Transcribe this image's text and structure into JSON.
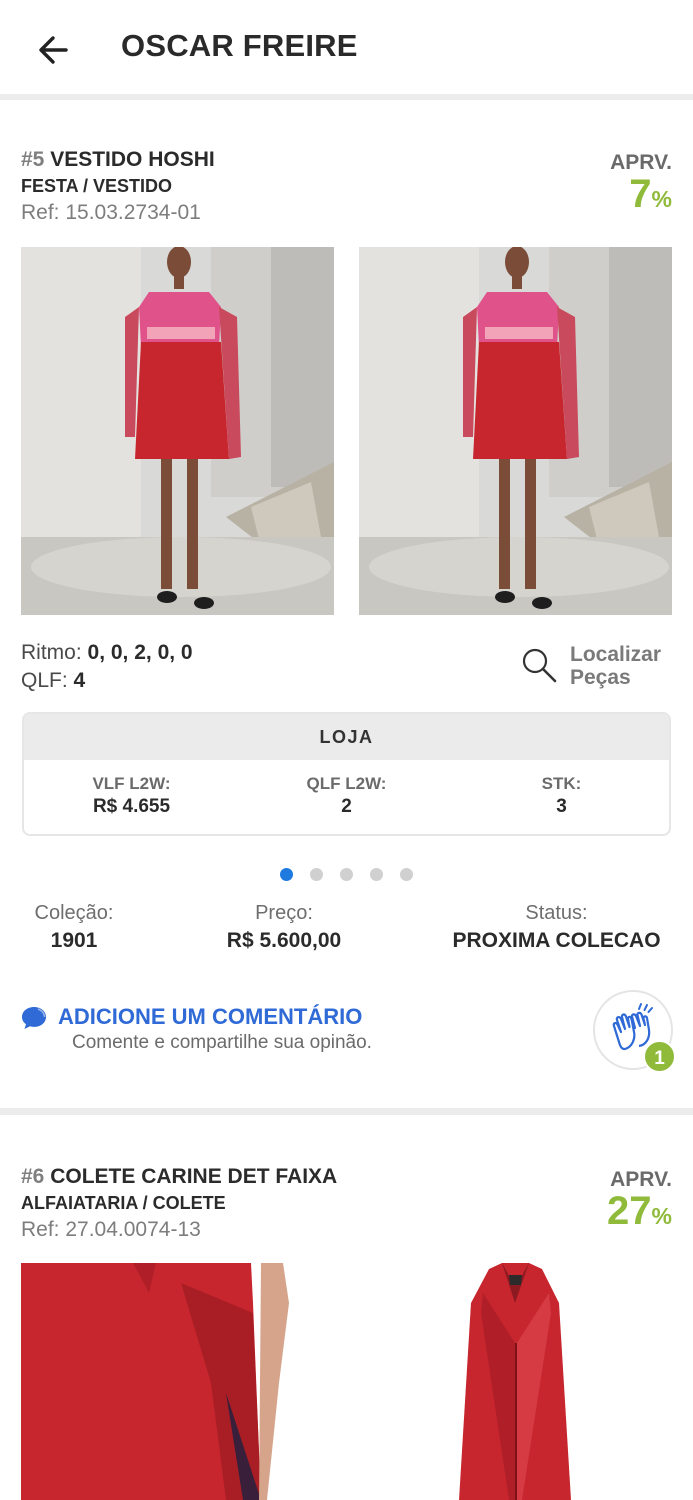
{
  "header": {
    "back_icon": "arrow-left-icon",
    "title": "OSCAR FREIRE"
  },
  "products": [
    {
      "number_prefix": "#5",
      "name": "VESTIDO HOSHI",
      "category": "FESTA / VESTIDO",
      "ref": "Ref: 15.03.2734-01",
      "approval_label": "APRV.",
      "approval_value": "7",
      "approval_unit": "%",
      "ritmo_label": "Ritmo:",
      "ritmo_value": "0, 0, 2, 0, 0",
      "qlf_label": "QLF:",
      "qlf_value": "4",
      "localizar_line1": "Localizar",
      "localizar_line2": "Peças",
      "loja": {
        "title": "LOJA",
        "columns": [
          {
            "label": "VLF L2W:",
            "value": "R$ 4.655"
          },
          {
            "label": "QLF L2W:",
            "value": "2"
          },
          {
            "label": "STK:",
            "value": "3"
          }
        ]
      },
      "carousel": {
        "count": 5,
        "active_index": 0
      },
      "info": [
        {
          "label": "Coleção:",
          "value": "1901"
        },
        {
          "label": "Preço:",
          "value": "R$ 5.600,00"
        },
        {
          "label": "Status:",
          "value": "PROXIMA COLECAO"
        }
      ],
      "comment_title": "ADICIONE UM COMENTÁRIO",
      "comment_subtitle": "Comente e compartilhe sua opinão.",
      "clap_count": "1"
    },
    {
      "number_prefix": "#6",
      "name": "COLETE CARINE DET FAIXA",
      "category": "ALFAIATARIA / COLETE",
      "ref": "Ref: 27.04.0074-13",
      "approval_label": "APRV.",
      "approval_value": "27",
      "approval_unit": "%"
    }
  ],
  "colors": {
    "accent_green": "#8fba3a",
    "link_blue": "#2f6ad6",
    "active_dot": "#1f7ae0",
    "dress_red": "#c8262e",
    "dress_pink": "#e0528a"
  }
}
